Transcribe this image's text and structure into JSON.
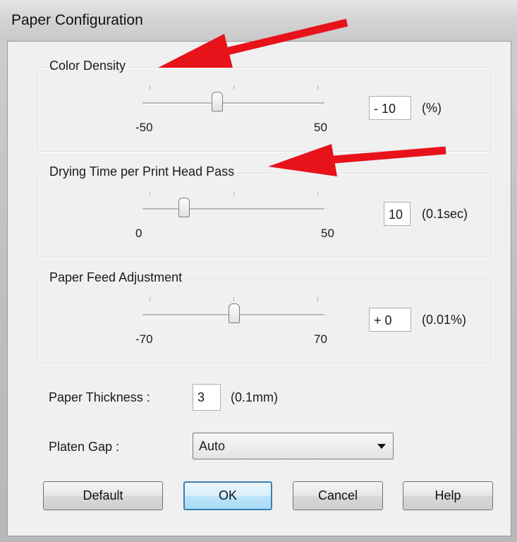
{
  "window": {
    "title": "Paper Configuration"
  },
  "color_density": {
    "label": "Color Density",
    "min_label": "-50",
    "max_label": "50",
    "min": -50,
    "max": 50,
    "value": -10,
    "value_text": "- 10",
    "unit": "(%)"
  },
  "drying_time": {
    "label": "Drying Time per Print Head Pass",
    "min_label": "0",
    "max_label": "50",
    "min": 0,
    "max": 50,
    "value": 10,
    "value_text": "10",
    "unit": "(0.1sec)"
  },
  "paper_feed": {
    "label": "Paper Feed Adjustment",
    "min_label": "-70",
    "max_label": "70",
    "min": -70,
    "max": 70,
    "value": 0,
    "value_text": "+ 0",
    "unit": "(0.01%)"
  },
  "paper_thickness": {
    "label": "Paper Thickness :",
    "value": "3",
    "unit": "(0.1mm)"
  },
  "platen_gap": {
    "label": "Platen Gap :",
    "value": "Auto"
  },
  "buttons": {
    "default": "Default",
    "ok": "OK",
    "cancel": "Cancel",
    "help": "Help"
  },
  "annotation_color": "#e8121b"
}
